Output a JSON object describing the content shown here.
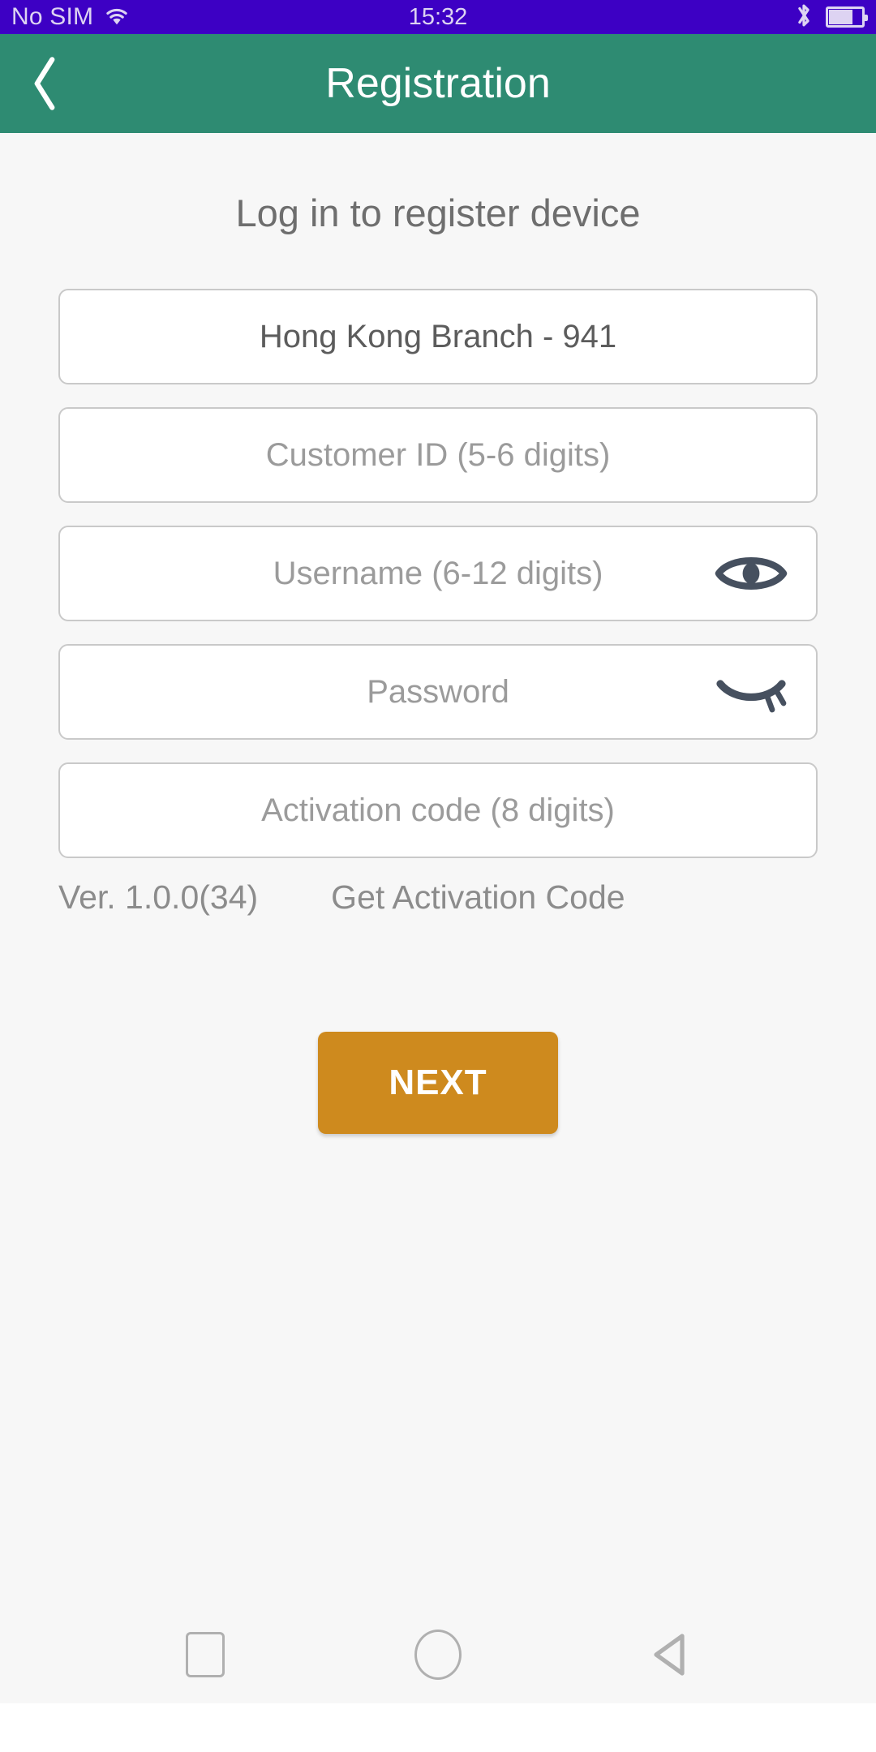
{
  "status_bar": {
    "sim_text": "No SIM",
    "time": "15:32",
    "wifi_icon": "wifi-icon",
    "bluetooth_icon": "bluetooth-icon",
    "battery_icon": "battery-icon",
    "background_color": "#3D00C4",
    "text_color": "#DDD3F2"
  },
  "app_bar": {
    "title": "Registration",
    "back_icon": "chevron-left-icon",
    "background_color": "#2E8B72",
    "title_color": "#FFFFFF"
  },
  "main": {
    "heading": "Log in to register device",
    "fields": [
      {
        "name": "branch",
        "text": "Hong Kong Branch - 941",
        "state": "value",
        "trailing_icon": null
      },
      {
        "name": "customer-id",
        "text": "Customer ID (5-6 digits)",
        "state": "placeholder",
        "trailing_icon": null
      },
      {
        "name": "username",
        "text": "Username (6-12 digits)",
        "state": "placeholder",
        "trailing_icon": "eye-visible-icon"
      },
      {
        "name": "password",
        "text": "Password",
        "state": "placeholder",
        "trailing_icon": "eye-hidden-icon"
      },
      {
        "name": "activation-code",
        "text": "Activation code (8 digits)",
        "state": "placeholder",
        "trailing_icon": null
      }
    ],
    "version_label": "Ver. 1.0.0(34)",
    "get_activation_code_label": "Get Activation Code",
    "next_button_label": "NEXT",
    "next_button_color": "#CE8A1E",
    "background_color": "#F7F7F7",
    "placeholder_color": "#9B9B9B",
    "value_color": "#5C5C5C",
    "eye_icon_color": "#46505F"
  },
  "nav_bar": {
    "recents_icon": "square-icon",
    "home_icon": "circle-icon",
    "back_icon": "triangle-left-icon",
    "icon_color": "#B0B0B0"
  }
}
